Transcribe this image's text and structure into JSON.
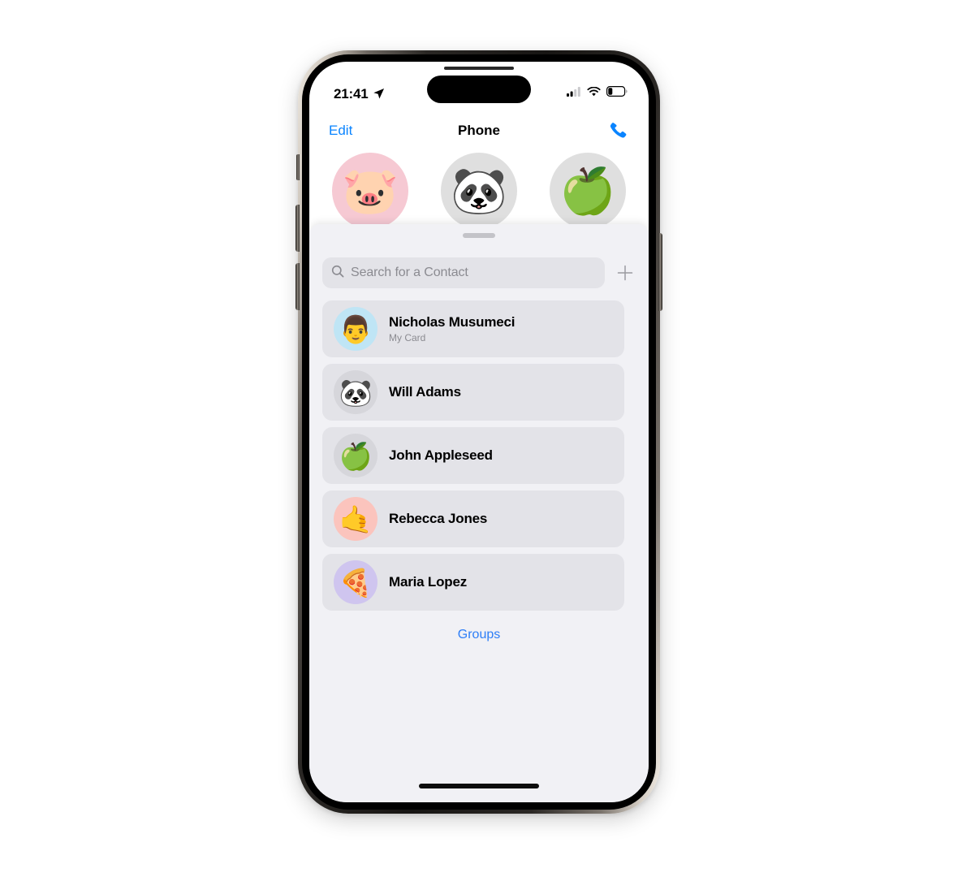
{
  "device": {
    "name": "iphone-14-pro",
    "buttons": [
      "mute-switch",
      "volume-up",
      "volume-down",
      "power"
    ]
  },
  "status_bar": {
    "time": "21:41",
    "location_icon": "location-arrow-icon",
    "cellular_icon": "cellular-bars-icon",
    "cellular_bars_filled": 2,
    "cellular_bars_total": 4,
    "wifi_icon": "wifi-icon",
    "battery_icon": "battery-icon",
    "battery_level_percent": 20
  },
  "nav_bar": {
    "edit_label": "Edit",
    "title": "Phone",
    "call_icon": "phone-handset-icon"
  },
  "memoji_strip": [
    {
      "name": "pig-memoji",
      "glyph": "🐷",
      "bg": "#f6c9d3"
    },
    {
      "name": "panda-memoji",
      "glyph": "🐼",
      "bg": "#dfdfdf"
    },
    {
      "name": "apple-memoji",
      "glyph": "🍏",
      "bg": "#dfdfdf"
    }
  ],
  "sheet": {
    "grabber": "sheet-grabber",
    "search": {
      "placeholder": "Search for a Contact",
      "value": "",
      "icon": "search-icon"
    },
    "add_button_icon": "plus-icon",
    "groups_label": "Groups"
  },
  "contacts": [
    {
      "name": "Nicholas Musumeci",
      "subtitle": "My Card",
      "avatar_glyph": "👨",
      "avatar_bg": "#bfe5f5"
    },
    {
      "name": "Will Adams",
      "subtitle": "",
      "avatar_glyph": "🐼",
      "avatar_bg": "#d6d6db"
    },
    {
      "name": "John Appleseed",
      "subtitle": "",
      "avatar_glyph": "🍏",
      "avatar_bg": "#d6d6db"
    },
    {
      "name": "Rebecca Jones",
      "subtitle": "",
      "avatar_glyph": "🤙",
      "avatar_bg": "#fbc4bd"
    },
    {
      "name": "Maria Lopez",
      "subtitle": "",
      "avatar_glyph": "🍕",
      "avatar_bg": "#cfc5ef"
    }
  ],
  "colors": {
    "accent_blue": "#0a84ff",
    "link_blue": "#2d7ef7",
    "sheet_bg": "#f1f1f5",
    "row_bg": "#e3e3e8",
    "placeholder_gray": "#8b8b91",
    "page_bg": "#ffffff"
  },
  "home_indicator": "home-indicator"
}
